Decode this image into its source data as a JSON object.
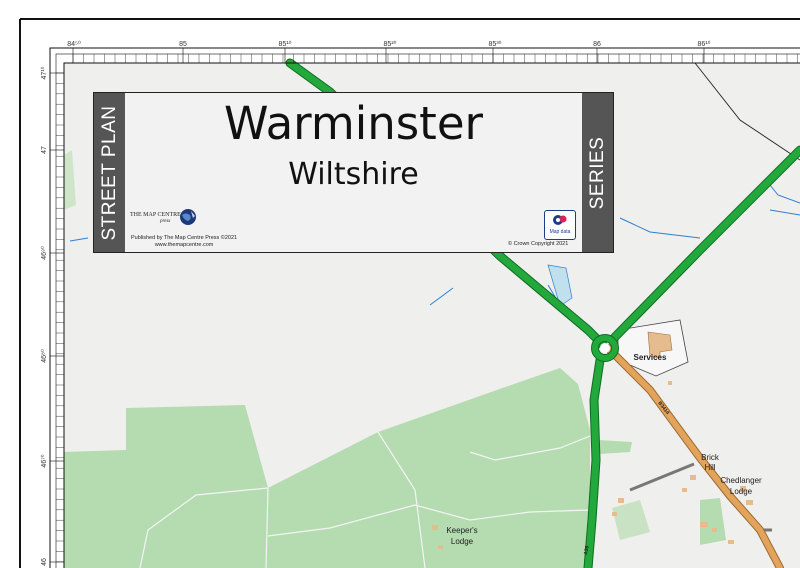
{
  "title_panel": {
    "left_band": "STREET PLAN",
    "right_band": "SERIES",
    "town": "Warminster",
    "county": "Wiltshire",
    "publisher_logo_line1": "THE MAP CENTRE",
    "publisher_logo_line2": "press",
    "publisher_line1": "Published by The Map Centre Press ©2021",
    "publisher_line2": "www.themapcentre.com",
    "os_logo_text": "Map data",
    "copyright": "© Crown Copyright 2021"
  },
  "grid": {
    "top_ticks": [
      "84⁵⁰",
      "85",
      "85¹⁰",
      "85²⁰",
      "85³⁰",
      "86",
      "86¹⁰"
    ],
    "left_ticks": [
      "47¹⁰",
      "47",
      "46⁹⁰",
      "46⁸⁰",
      "46⁷⁰",
      "46"
    ]
  },
  "labels": {
    "services": "Services",
    "brick": "Brick",
    "hill": "Hill",
    "chedlanger": "Chedlanger",
    "chedlanger_lodge": "Lodge",
    "keepers": "Keeper's",
    "keepers_lodge": "Lodge",
    "road_b": "B3414",
    "road_a": "A36"
  },
  "colors": {
    "primary_road": "#23a83c",
    "b_road": "#e2a45c",
    "woodland": "#b5dbb0",
    "background": "#efefed",
    "water": "#2f7fd1",
    "panel_band": "#555555"
  }
}
